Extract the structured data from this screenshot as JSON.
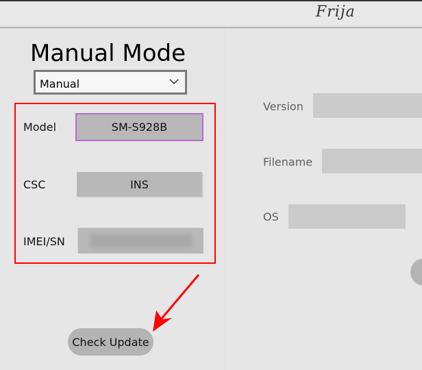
{
  "window": {
    "app_title": "Frija"
  },
  "left": {
    "title": "Manual Mode",
    "mode_select": {
      "value": "Manual",
      "icon": "chevron-down-icon"
    },
    "fields": {
      "model": {
        "label": "Model",
        "value": "SM-S928B"
      },
      "csc": {
        "label": "CSC",
        "value": "INS"
      },
      "imei": {
        "label": "IMEI/SN",
        "value": ""
      }
    },
    "check_update_label": "Check Update",
    "annotation": {
      "highlight_color": "#ff0000",
      "arrow_color": "#ff0000"
    }
  },
  "right": {
    "fields": {
      "version": {
        "label": "Version",
        "value": ""
      },
      "filename": {
        "label": "Filename",
        "value": ""
      },
      "os": {
        "label": "OS",
        "value": ""
      }
    }
  }
}
